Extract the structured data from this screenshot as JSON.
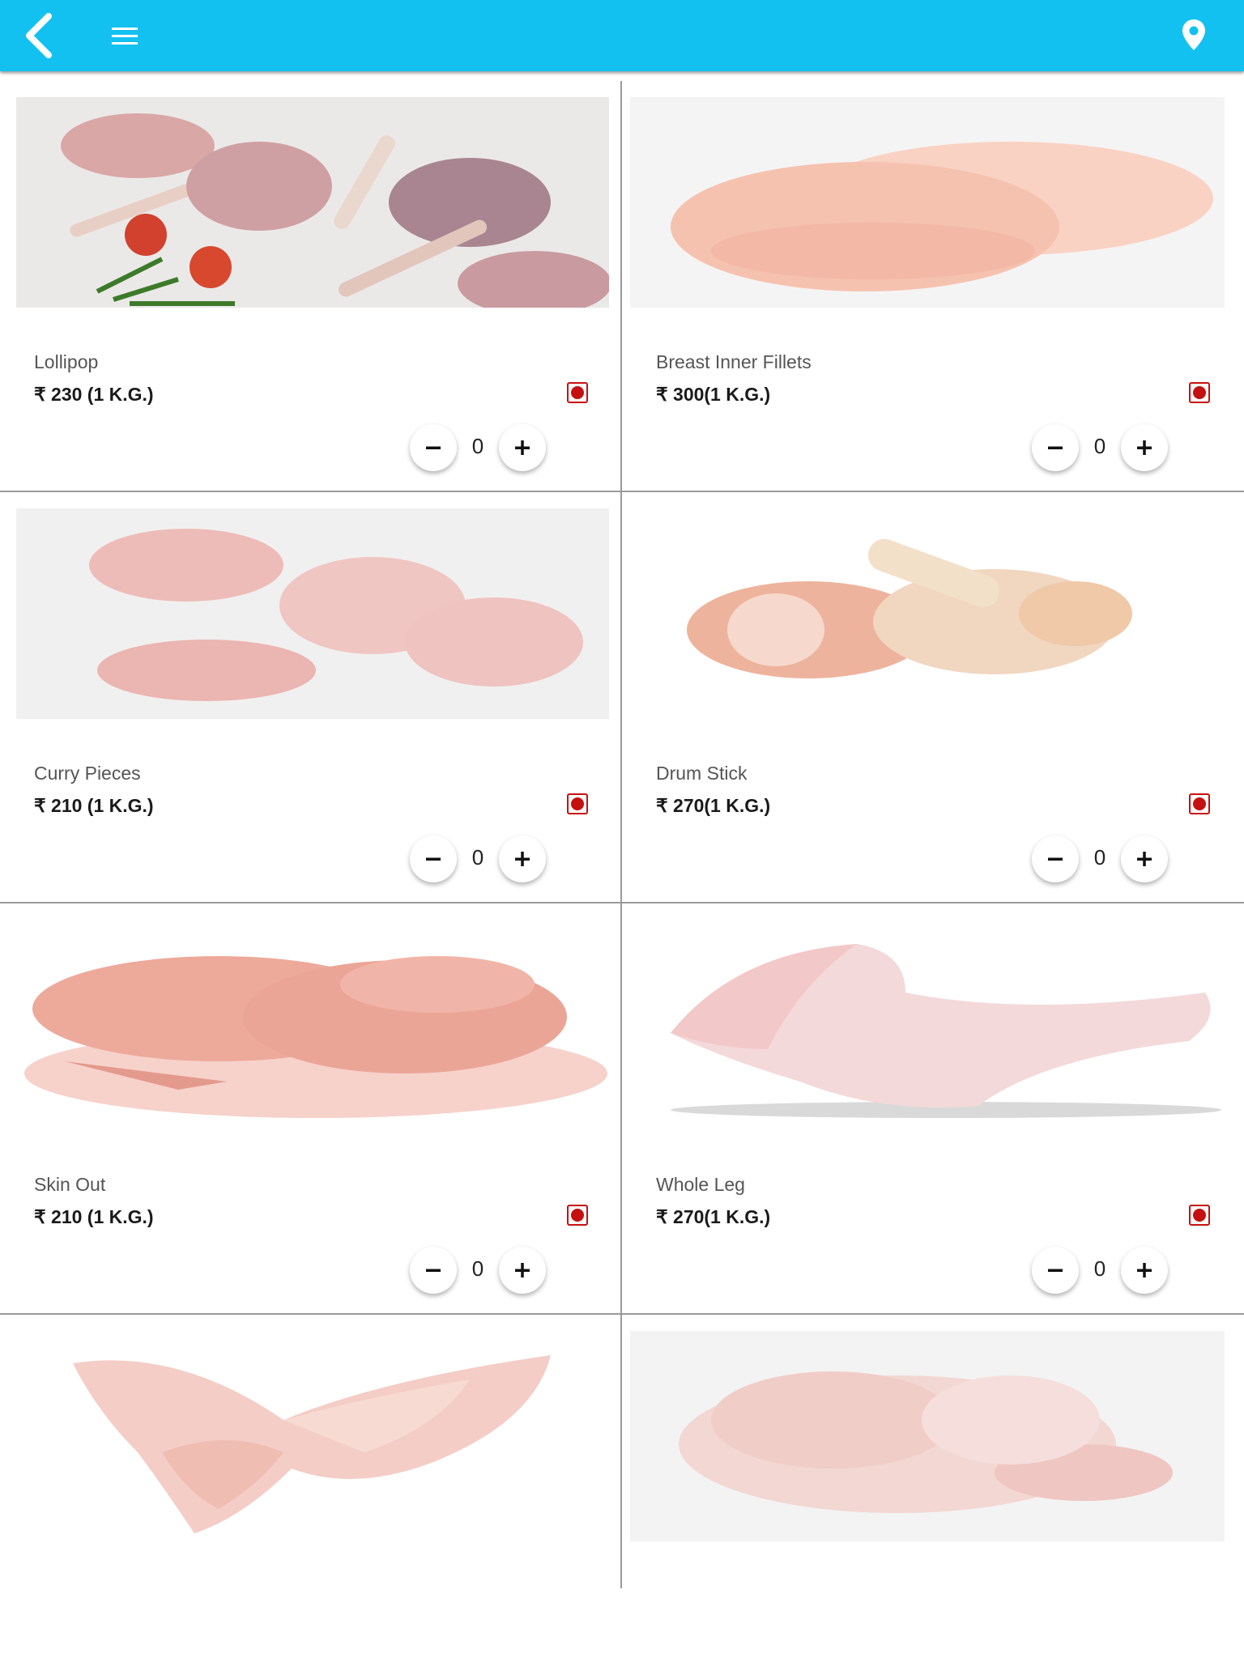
{
  "appbar": {
    "background": "#13c1f1",
    "icons": [
      "back-chevron-icon",
      "hamburger-menu-icon",
      "location-pin-icon"
    ]
  },
  "currency_symbol": "₹",
  "products": [
    {
      "name": "Lollipop",
      "price": "₹ 230 (1 K.G.)",
      "qty": "0",
      "image": "chicken-lollipop-image"
    },
    {
      "name": "Breast Inner Fillets",
      "price": "₹ 300(1 K.G.)",
      "qty": "0",
      "image": "breast-fillets-image"
    },
    {
      "name": "Curry Pieces",
      "price": "₹ 210 (1 K.G.)",
      "qty": "0",
      "image": "curry-pieces-image"
    },
    {
      "name": "Drum Stick",
      "price": "₹ 270(1 K.G.)",
      "qty": "0",
      "image": "drumstick-image"
    },
    {
      "name": "Skin Out",
      "price": "₹ 210 (1 K.G.)",
      "qty": "0",
      "image": "skin-out-chicken-image"
    },
    {
      "name": "Whole Leg",
      "price": "₹ 270(1 K.G.)",
      "qty": "0",
      "image": "whole-leg-image"
    },
    {
      "image": "chicken-wings-image"
    },
    {
      "image": "whole-chicken-image"
    }
  ],
  "colors": {
    "nonveg_mark": "#c41010",
    "divider": "#9a9a9a",
    "meat_pink": "#f4c3b4"
  }
}
